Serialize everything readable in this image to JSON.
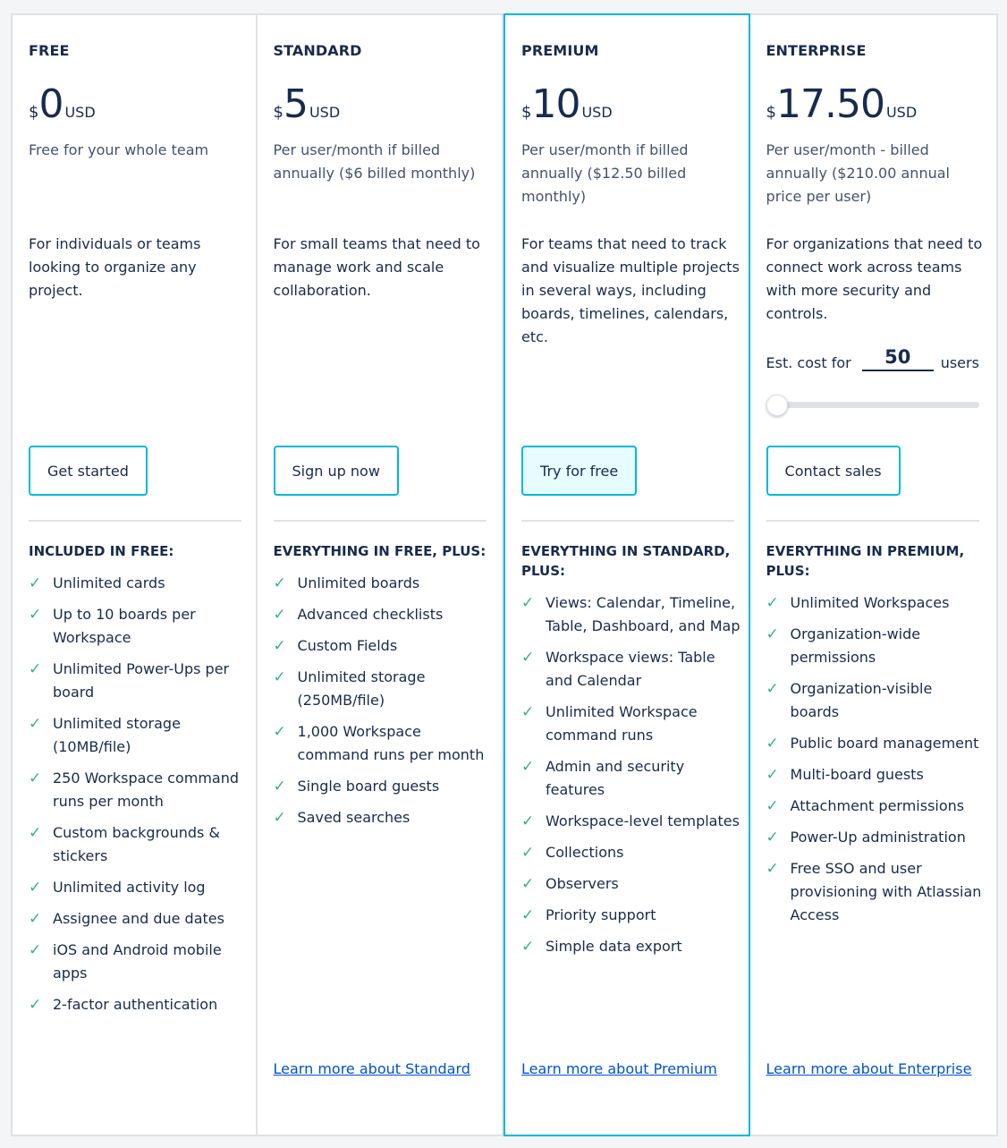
{
  "plans": [
    {
      "tier": "FREE",
      "currency_symbol": "$",
      "amount": "0",
      "currency_unit": "USD",
      "billing": "Free for your whole team",
      "description": "For individuals or teams looking to organize any project.",
      "cta": "Get started",
      "features_title": "INCLUDED IN FREE:",
      "features": [
        "Unlimited cards",
        "Up to 10 boards per Workspace",
        "Unlimited Power-Ups per board",
        "Unlimited storage (10MB/file)",
        "250 Workspace command runs per month",
        "Custom backgrounds & stickers",
        "Unlimited activity log",
        "Assignee and due dates",
        "iOS and Android mobile apps",
        "2-factor authentication"
      ]
    },
    {
      "tier": "STANDARD",
      "currency_symbol": "$",
      "amount": "5",
      "currency_unit": "USD",
      "billing": "Per user/month if billed annually ($6 billed monthly)",
      "description": "For small teams that need to manage work and scale collaboration.",
      "cta": "Sign up now",
      "features_title": "EVERYTHING IN FREE, PLUS:",
      "features": [
        "Unlimited boards",
        "Advanced checklists",
        "Custom Fields",
        "Unlimited storage (250MB/file)",
        "1,000 Workspace command runs per month",
        "Single board guests",
        "Saved searches"
      ],
      "learn_more": "Learn more about Standard"
    },
    {
      "tier": "PREMIUM",
      "currency_symbol": "$",
      "amount": "10",
      "currency_unit": "USD",
      "billing": "Per user/month if billed annually ($12.50 billed monthly)",
      "description": "For teams that need to track and visualize multiple projects in several ways, including boards, timelines, calendars, etc.",
      "cta": "Try for free",
      "features_title": "EVERYTHING IN STANDARD, PLUS:",
      "features": [
        "Views: Calendar, Timeline, Table, Dashboard, and Map",
        "Workspace views: Table and Calendar",
        "Unlimited Workspace command runs",
        "Admin and security features",
        "Workspace-level templates",
        "Collections",
        "Observers",
        "Priority support",
        "Simple data export"
      ],
      "learn_more": "Learn more about Premium"
    },
    {
      "tier": "ENTERPRISE",
      "currency_symbol": "$",
      "amount": "17.50",
      "currency_unit": "USD",
      "billing": "Per user/month - billed annually ($210.00 annual price per user)",
      "description": "For organizations that need to connect work across teams with more security and controls.",
      "estimate": {
        "label_before": "Est. cost for",
        "users": "50",
        "label_after": "users",
        "slider_fraction": 0.0
      },
      "cta": "Contact sales",
      "features_title": "EVERYTHING IN PREMIUM, PLUS:",
      "features": [
        "Unlimited Workspaces",
        "Organization-wide permissions",
        "Organization-visible boards",
        "Public board management",
        "Multi-board guests",
        "Attachment permissions",
        "Power-Up administration",
        "Free SSO and user provisioning with Atlassian Access"
      ],
      "learn_more": "Learn more about Enterprise"
    }
  ],
  "icons": {
    "feature_check": "✓"
  },
  "colors": {
    "accent": "#00b8d9",
    "check": "#36b37e",
    "link": "#0052cc",
    "text": "#172b4d",
    "muted": "#42526e"
  }
}
